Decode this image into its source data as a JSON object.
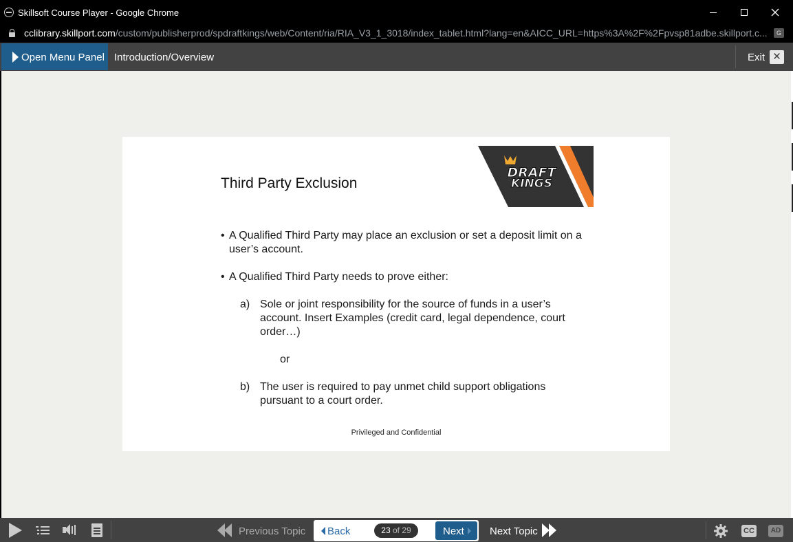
{
  "window": {
    "title": "Skillsoft Course Player - Google Chrome"
  },
  "address_bar": {
    "host": "cclibrary.skillport.com",
    "path": "/custom/publisherprod/spdraftkings/web/Content/ria/RIA_V3_1_3018/index_tablet.html?lang=en&AICC_URL=https%3A%2F%2Fpvsp81adbe.skillport.c..."
  },
  "header": {
    "menu_label": "Open Menu Panel",
    "topic_title": "Introduction/Overview",
    "exit_label": "Exit"
  },
  "slide": {
    "title": "Third Party Exclusion",
    "logo_text_top": "DRAFT",
    "logo_text_bottom": "KINGS",
    "bullets": [
      "A Qualified Third Party may place an exclusion or set a deposit limit on a user’s account.",
      "A Qualified Third Party needs to prove either:"
    ],
    "sub_items": [
      {
        "mark": "a)",
        "text": "Sole or joint responsibility for the source of funds in a user’s account.  Insert Examples  (credit card, legal dependence, court order…)"
      },
      {
        "mark": "b)",
        "text": "The user is required to pay unmet child support obligations pursuant to a court order."
      }
    ],
    "or_text": "or",
    "footer": "Privileged  and Confidential"
  },
  "toolbar": {
    "previous_topic_label": "Previous Topic",
    "back_label": "Back",
    "current_page": "23",
    "of_label": "of 29",
    "next_label": "Next",
    "next_topic_label": "Next Topic",
    "cc_label": "CC",
    "ad_label": "AD"
  },
  "colors": {
    "header_bg": "#424242",
    "accent_blue": "#1f5d8c",
    "content_bg": "#efefec",
    "logo_orange": "#f07d2b"
  }
}
